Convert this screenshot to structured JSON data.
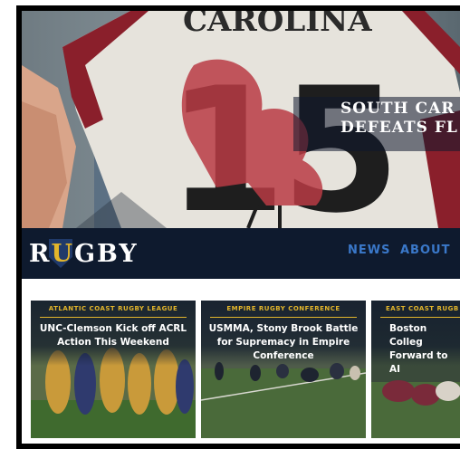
{
  "hero": {
    "jersey_text": "CAROLINA",
    "jersey_number": "15",
    "headline_line1": "SOUTH CAR",
    "headline_line2": "DEFEATS FL"
  },
  "header": {
    "logo_r": "R",
    "logo_u": "U",
    "logo_rest": "GBY",
    "nav": [
      {
        "label": "NEWS"
      },
      {
        "label": "ABOUT"
      }
    ]
  },
  "cards": [
    {
      "league": "ATLANTIC COAST RUGBY LEAGUE",
      "title": "UNC-Clemson Kick off ACRL Action This Weekend"
    },
    {
      "league": "EMPIRE RUGBY CONFERENCE",
      "title": "USMMA, Stony Brook Battle for Supremacy in Empire Conference"
    },
    {
      "league": "EAST COAST RUGB",
      "title": "Boston Colleg Forward to AI"
    }
  ],
  "colors": {
    "navy": "#0e1a2e",
    "gold": "#e2b52b",
    "nav_link": "#3a78c9",
    "jersey_red": "#8a1f2b"
  }
}
